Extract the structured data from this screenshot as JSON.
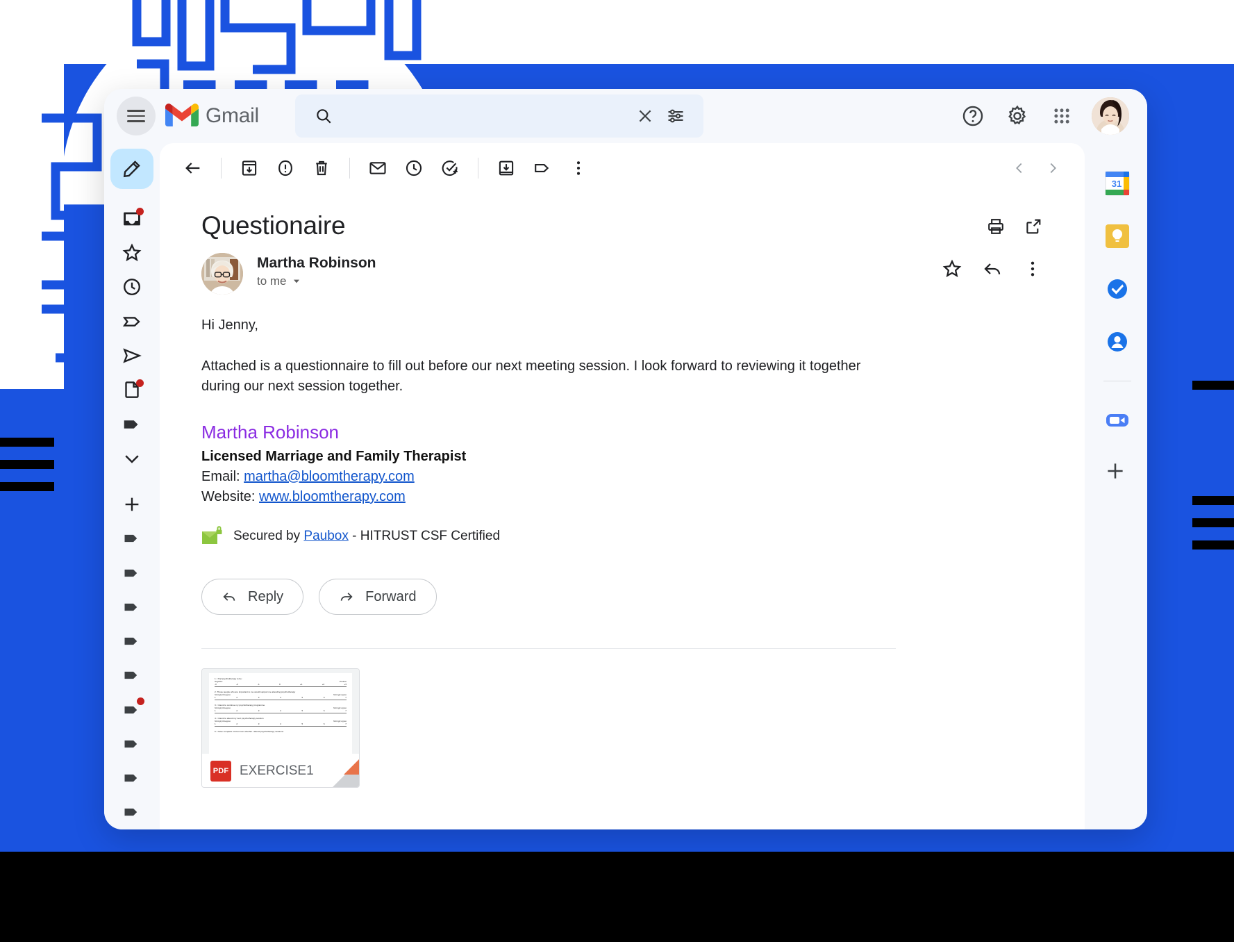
{
  "header": {
    "menu_label": "Main menu",
    "brand": "Gmail",
    "search": {
      "value": "",
      "placeholder": ""
    },
    "icons": [
      "search-icon",
      "clear-search-icon",
      "search-options-icon",
      "help-icon",
      "settings-icon",
      "google-apps-icon",
      "account-avatar"
    ]
  },
  "rail": {
    "compose_label": "Compose",
    "items": [
      {
        "name": "inbox",
        "badge": true
      },
      {
        "name": "starred",
        "badge": false
      },
      {
        "name": "snoozed",
        "badge": false
      },
      {
        "name": "important",
        "badge": false
      },
      {
        "name": "sent",
        "badge": false
      },
      {
        "name": "drafts",
        "badge": true
      },
      {
        "name": "labels",
        "badge": false
      },
      {
        "name": "more",
        "badge": false
      }
    ],
    "label_items": [
      {
        "name": "create-label",
        "badge": false
      },
      {
        "name": "label-1",
        "badge": false
      },
      {
        "name": "label-2",
        "badge": false
      },
      {
        "name": "label-3",
        "badge": false
      },
      {
        "name": "label-4",
        "badge": false
      },
      {
        "name": "label-5",
        "badge": false
      },
      {
        "name": "label-6",
        "badge": true
      },
      {
        "name": "label-7",
        "badge": false
      },
      {
        "name": "label-8",
        "badge": false
      },
      {
        "name": "label-9",
        "badge": false
      }
    ]
  },
  "toolbar": {
    "back": "Back to Inbox",
    "archive": "Archive",
    "spam": "Report spam",
    "delete": "Delete",
    "unread": "Mark as unread",
    "snooze": "Snooze",
    "task": "Add to tasks",
    "move": "Move to Inbox",
    "labels": "Labels",
    "more": "More",
    "prev": "Newer",
    "next": "Older"
  },
  "email": {
    "subject": "Questionaire",
    "print_label": "Print all",
    "popout_label": "Open in new window",
    "sender_name": "Martha Robinson",
    "recipient": "to me",
    "star_label": "Star",
    "reply_label": "Reply",
    "more_label": "More",
    "greeting": "Hi Jenny,",
    "paragraph": "Attached is a questionnaire to fill out before our next meeting session. I look forward to reviewing it together during our next session together.",
    "signature": {
      "name": "Martha Robinson",
      "title": "Licensed Marriage and Family Therapist",
      "email_label": "Email:",
      "email_value": "martha@bloomtherapy.com",
      "website_label": "Website:",
      "website_value": "www.bloomtherapy.com",
      "name_color": "#8a2be2"
    },
    "secured": {
      "prefix": "Secured by",
      "link": "Paubox",
      "suffix": "- HITRUST CSF Certified"
    },
    "buttons": {
      "reply": "Reply",
      "forward": "Forward"
    },
    "attachment": {
      "filename": "EXERCISE1",
      "type": "PDF",
      "preview_questions": [
        {
          "text": "1. I find psychotherapy to be:",
          "left": "Negative",
          "right": "Positive",
          "scale": [
            "-3",
            "-2",
            "-1",
            "0",
            "+1",
            "+2",
            "+3"
          ]
        },
        {
          "text": "2. Those people who are important to me would support me attending psychotherapy",
          "left": "Strongly Disagree",
          "right": "Strongly Agree",
          "scale": [
            "1",
            "2",
            "3",
            "4",
            "5",
            "6",
            "7"
          ]
        },
        {
          "text": "3. I intend to continue my psychotherapy programme",
          "left": "Strongly Disagree",
          "right": "Strongly Agree",
          "scale": [
            "1",
            "2",
            "3",
            "4",
            "5",
            "6",
            "7"
          ]
        },
        {
          "text": "4. I intend to attend my next psychotherapy session",
          "left": "Strongly Disagree",
          "right": "Strongly Agree",
          "scale": [
            "1",
            "2",
            "3",
            "4",
            "5",
            "6",
            "7"
          ]
        },
        {
          "text": "5. I have complete control over whether I attend psychotherapy sessions",
          "left": "",
          "right": "",
          "scale": []
        }
      ]
    }
  },
  "apps": [
    {
      "name": "google-calendar-icon",
      "label": "Calendar",
      "badge": "31"
    },
    {
      "name": "google-keep-icon",
      "label": "Keep"
    },
    {
      "name": "google-tasks-icon",
      "label": "Tasks"
    },
    {
      "name": "google-contacts-icon",
      "label": "Contacts"
    },
    {
      "name": "zoom-icon",
      "label": "Zoom"
    },
    {
      "name": "add-app-icon",
      "label": "Get Add-ons"
    }
  ],
  "colors": {
    "background_blue": "#1a53e0",
    "accent_blue": "#1a73e8",
    "compose_blue": "#c2e7ff",
    "badge_red": "#c5221f",
    "link_blue": "#1155cc",
    "paubox_green": "#8cc63f"
  }
}
